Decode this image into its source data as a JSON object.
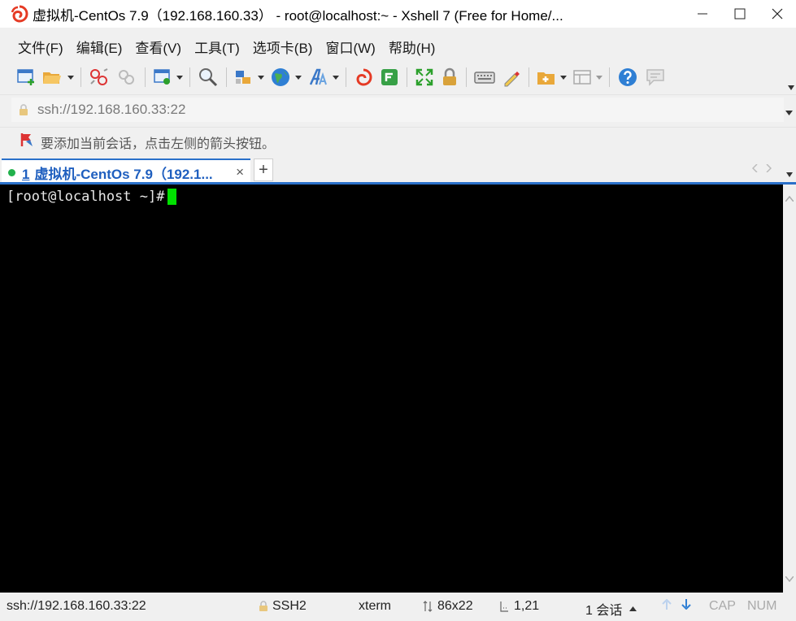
{
  "window": {
    "title": "虚拟机-CentOs 7.9（192.168.160.33） - root@localhost:~ - Xshell 7 (Free for Home/..."
  },
  "menu": {
    "items": [
      "文件(F)",
      "编辑(E)",
      "查看(V)",
      "工具(T)",
      "选项卡(B)",
      "窗口(W)",
      "帮助(H)"
    ]
  },
  "address": {
    "value": "ssh://192.168.160.33:22"
  },
  "info": {
    "text": "要添加当前会话，点击左侧的箭头按钮。"
  },
  "tab": {
    "number": "1",
    "label": "虚拟机-CentOs 7.9（192.1...",
    "close": "×",
    "add": "+"
  },
  "terminal": {
    "prompt": "[root@localhost ~]#"
  },
  "status": {
    "address": "ssh://192.168.160.33:22",
    "protocol": "SSH2",
    "term": "xterm",
    "size": "86x22",
    "position": "1,21",
    "sessions": "1 会话",
    "cap": "CAP",
    "num": "NUM"
  },
  "colors": {
    "accent": "#2a70c9",
    "cursor": "#00e000",
    "terminal_bg": "#000000"
  },
  "icons": [
    "xshell-logo-icon",
    "new-session-icon",
    "open-folder-icon",
    "disconnect-icon",
    "reconnect-icon",
    "session-properties-icon",
    "find-icon",
    "transfer-icon",
    "globe-icon",
    "font-icon",
    "xshell-icon",
    "xftp-icon",
    "fullscreen-icon",
    "lock-icon",
    "keyboard-icon",
    "highlight-icon",
    "compose-icon",
    "layout-icon",
    "help-icon",
    "chat-icon"
  ]
}
